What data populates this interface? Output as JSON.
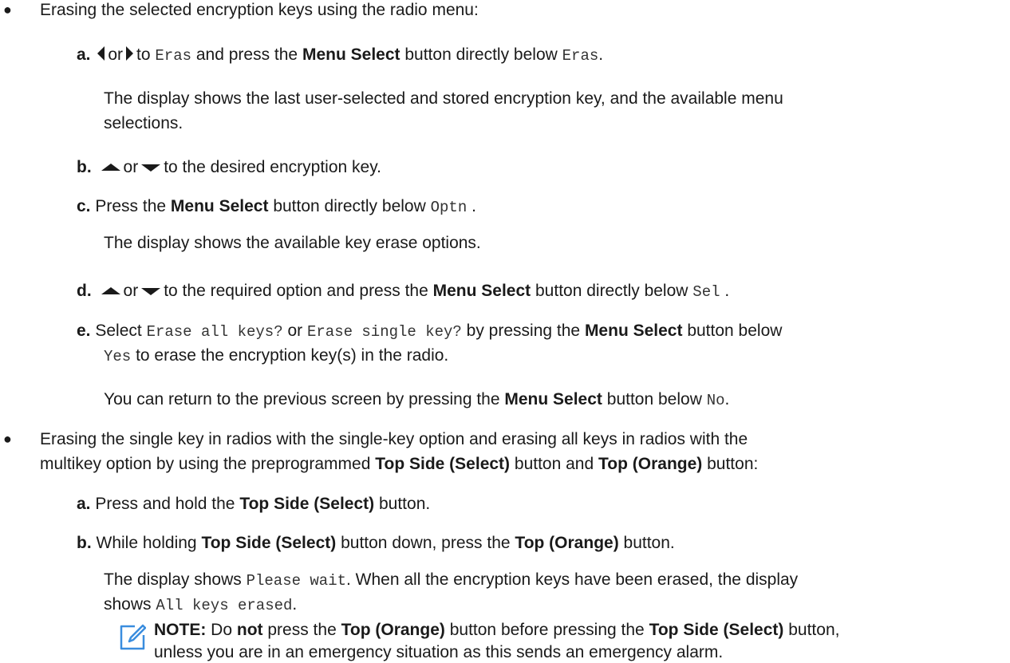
{
  "bullet_char": "●",
  "section1": {
    "intro": "Erasing the selected encryption keys using the radio menu:",
    "step_a": {
      "mark": "a.",
      "or": "or",
      "to": "to",
      "eras1": "Eras",
      "press": "and press the",
      "button": "Menu Select",
      "below": "button directly below",
      "eras2": "Eras",
      "period": ".",
      "result1": "The display shows the last user-selected and stored encryption key, and the available menu",
      "result2": "selections."
    },
    "step_b": {
      "mark": "b.",
      "or": "or",
      "text": "to the desired encryption key."
    },
    "step_c": {
      "mark": "c.",
      "press": "Press the",
      "button": "Menu Select",
      "below": "button directly below",
      "code": "Optn",
      "period": ".",
      "result": "The display shows the available key erase options."
    },
    "step_d": {
      "mark": "d.",
      "or": "or",
      "text": "to the required option and press the",
      "button": "Menu Select",
      "below": "button directly below",
      "code": "Sel",
      "period": "."
    },
    "step_e": {
      "mark": "e.",
      "select": "Select",
      "code1": "Erase all keys?",
      "or": "or",
      "code2": "Erase single key?",
      "by": "by pressing the",
      "button": "Menu Select",
      "below": "button below",
      "code3": "Yes",
      "rest": "to erase the encryption key(s) in the radio.",
      "return_text": "You can return to the previous screen by pressing the",
      "return_button": "Menu Select",
      "return_below": "button below",
      "code4": "No",
      "period": "."
    }
  },
  "section2": {
    "intro1": "Erasing the single key in radios with the single-key option and erasing all keys in radios with the",
    "intro2_a": "multikey option by using the preprogrammed",
    "intro2_b": "Top Side (Select)",
    "intro2_c": "button and",
    "intro2_d": "Top (Orange)",
    "intro2_e": "button:",
    "step_a": {
      "mark": "a.",
      "text1": "Press and hold the",
      "button": "Top Side (Select)",
      "text2": "button."
    },
    "step_b": {
      "mark": "b.",
      "text1": "While holding",
      "button1": "Top Side (Select)",
      "text2": "button down, press the",
      "button2": "Top (Orange)",
      "text3": "button.",
      "result1_a": "The display shows",
      "result1_code": "Please wait",
      "result1_b": ". When all the encryption keys have been erased, the display",
      "result2_a": "shows",
      "result2_code": "All keys erased",
      "result2_b": "."
    }
  },
  "note": {
    "label": "NOTE:",
    "t1": "Do",
    "not": "not",
    "t2": "press the",
    "button1": "Top (Orange)",
    "t3": "button before pressing the",
    "button2": "Top Side (Select)",
    "t4": "button,",
    "line2": "unless you are in an emergency situation as this sends an emergency alarm."
  }
}
